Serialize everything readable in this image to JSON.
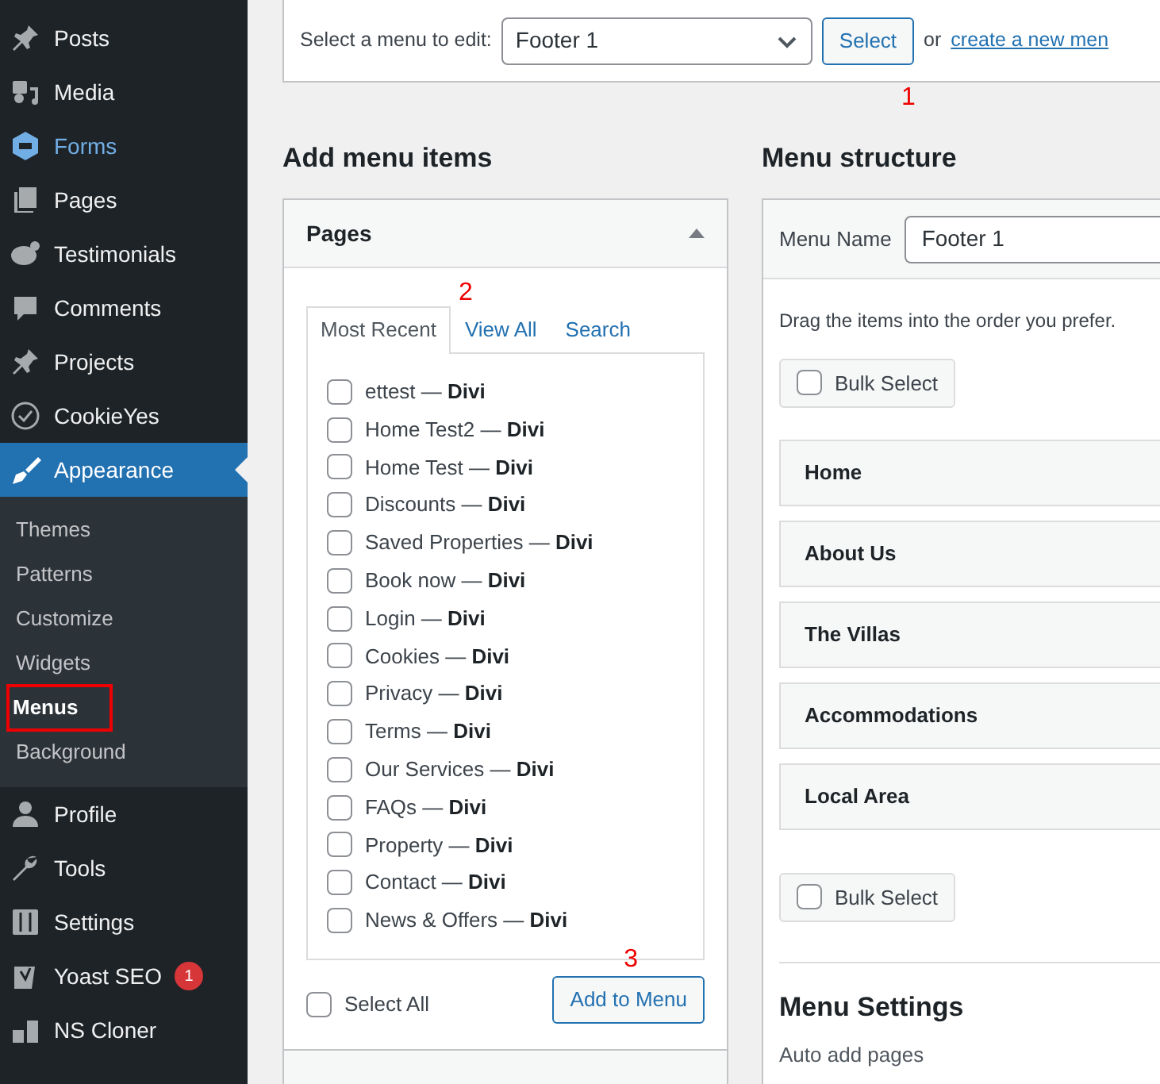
{
  "sidebar": {
    "items": [
      {
        "label": "Posts",
        "selected": false,
        "hovered": false
      },
      {
        "label": "Media",
        "selected": false,
        "hovered": false
      },
      {
        "label": "Forms",
        "selected": false,
        "hovered": true
      },
      {
        "label": "Pages",
        "selected": false,
        "hovered": false
      },
      {
        "label": "Testimonials",
        "selected": false,
        "hovered": false
      },
      {
        "label": "Comments",
        "selected": false,
        "hovered": false
      },
      {
        "label": "Projects",
        "selected": false,
        "hovered": false
      },
      {
        "label": "CookieYes",
        "selected": false,
        "hovered": false
      },
      {
        "label": "Appearance",
        "selected": true,
        "hovered": false,
        "children": [
          {
            "label": "Themes",
            "selected": false,
            "outlined": false
          },
          {
            "label": "Patterns",
            "selected": false,
            "outlined": false
          },
          {
            "label": "Customize",
            "selected": false,
            "outlined": false
          },
          {
            "label": "Widgets",
            "selected": false,
            "outlined": false
          },
          {
            "label": "Menus",
            "selected": true,
            "outlined": true
          },
          {
            "label": "Background",
            "selected": false,
            "outlined": false
          }
        ]
      },
      {
        "label": "Profile",
        "selected": false,
        "hovered": false
      },
      {
        "label": "Tools",
        "selected": false,
        "hovered": false
      },
      {
        "label": "Settings",
        "selected": false,
        "hovered": false
      },
      {
        "label": "Yoast SEO",
        "selected": false,
        "hovered": false,
        "badge": "1"
      },
      {
        "label": "NS Cloner",
        "selected": false,
        "hovered": false
      }
    ]
  },
  "menu_picker": {
    "label": "Select a menu to edit:",
    "value": "Footer 1",
    "button": "Select",
    "annotation": "1",
    "or_text": "or",
    "link": "create a new men"
  },
  "add_menu_items": {
    "heading": "Add menu items",
    "pages_panel": {
      "title": "Pages",
      "expanded": true,
      "annotation": "2",
      "tabs": [
        {
          "label": "Most Recent",
          "selected": true
        },
        {
          "label": "View All",
          "selected": false
        },
        {
          "label": "Search",
          "selected": false
        }
      ],
      "pages": [
        {
          "title": "ettest — **Divi**",
          "checked": false
        },
        {
          "title": "Home Test2 — **Divi**",
          "checked": false
        },
        {
          "title": "Home Test — **Divi**",
          "checked": false
        },
        {
          "title": "Discounts — **Divi**",
          "checked": false
        },
        {
          "title": "Saved Properties — **Divi**",
          "checked": false
        },
        {
          "title": "Book now — **Divi**",
          "checked": false
        },
        {
          "title": "Login — **Divi**",
          "checked": false
        },
        {
          "title": "Cookies — **Divi**",
          "checked": false
        },
        {
          "title": "Privacy — **Divi**",
          "checked": false
        },
        {
          "title": "Terms — **Divi**",
          "checked": false
        },
        {
          "title": "Our Services — **Divi**",
          "checked": false
        },
        {
          "title": "FAQs — **Divi**",
          "checked": false
        },
        {
          "title": "Property — **Divi**",
          "checked": false
        },
        {
          "title": "Contact — **Divi**",
          "checked": false
        },
        {
          "title": "News & Offers — **Divi**",
          "checked": false
        }
      ],
      "select_all": {
        "label": "Select All",
        "checked": false
      },
      "add_button": "Add to Menu",
      "add_annotation": "3"
    }
  },
  "menu_structure": {
    "heading": "Menu structure",
    "name_label": "Menu Name",
    "name_value": "Footer 1",
    "instructions": "Drag the items into the order you prefer.",
    "bulk_select_top": {
      "label": "Bulk Select",
      "checked": false
    },
    "items": [
      "Home",
      "About Us",
      "The Villas",
      "Accommodations",
      "Local Area"
    ],
    "bulk_select_bottom": {
      "label": "Bulk Select",
      "checked": false
    },
    "settings_heading": "Menu Settings",
    "auto_add_label": "Auto add pages"
  }
}
